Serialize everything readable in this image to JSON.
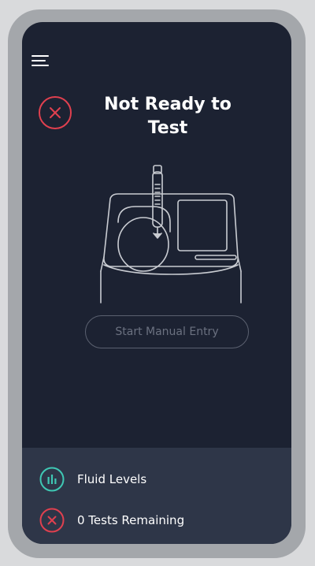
{
  "header": {
    "title": "Not Ready to Test",
    "status_icon": "close-icon",
    "menu_icon": "hamburger-menu-icon"
  },
  "illustration": {
    "icon": "test-device-with-sample-tube-icon"
  },
  "actions": {
    "manual_entry_label": "Start Manual Entry"
  },
  "status_list": {
    "items": [
      {
        "icon": "bar-chart-icon",
        "label": "Fluid Levels",
        "color": "#3fc8b4"
      },
      {
        "icon": "close-icon",
        "label": "0 Tests Remaining",
        "color": "#e0404f"
      }
    ]
  },
  "colors": {
    "background": "#1c2232",
    "panel": "#2e3648",
    "error": "#e0404f",
    "ok": "#3fc8b4",
    "text": "#ffffff",
    "disabled": "#6b7180"
  }
}
